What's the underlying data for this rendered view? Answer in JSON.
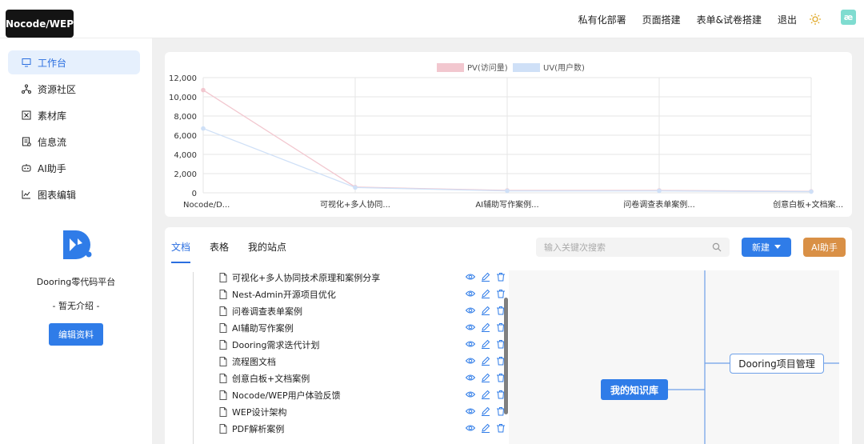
{
  "app": {
    "logo": "Nocode/WEP"
  },
  "topnav": [
    "私有化部署",
    "页面搭建",
    "表单&试卷搭建",
    "退出"
  ],
  "user_avatar": "æ",
  "sidebar": {
    "items": [
      {
        "label": "工作台",
        "icon": "monitor-icon",
        "active": true
      },
      {
        "label": "资源社区",
        "icon": "share-icon",
        "active": false
      },
      {
        "label": "素材库",
        "icon": "library-icon",
        "active": false
      },
      {
        "label": "信息流",
        "icon": "feed-icon",
        "active": false
      },
      {
        "label": "AI助手",
        "icon": "robot-icon",
        "active": false
      },
      {
        "label": "图表编辑",
        "icon": "chart-icon",
        "active": false
      }
    ]
  },
  "profile": {
    "name": "Dooring零代码平台",
    "desc": "- 暂无介绍 -",
    "edit_label": "编辑资料"
  },
  "chart_data": {
    "type": "line",
    "categories": [
      "Nocode/D...",
      "可视化+多人协同...",
      "AI辅助写作案例...",
      "问卷调查表单案例...",
      "创意白板+文档案..."
    ],
    "series": [
      {
        "name": "PV(访问量)",
        "values": [
          10700,
          600,
          250,
          250,
          150
        ],
        "color": "#f2c7cf"
      },
      {
        "name": "UV(用户数)",
        "values": [
          6700,
          550,
          200,
          200,
          120
        ],
        "color": "#cfe0f7"
      }
    ],
    "yticks": [
      "0",
      "2,000",
      "4,000",
      "6,000",
      "8,000",
      "10,000",
      "12,000"
    ],
    "ylim": [
      0,
      12000
    ],
    "legend": "top-center",
    "grid": true
  },
  "tabs": [
    {
      "label": "文档",
      "active": true
    },
    {
      "label": "表格",
      "active": false
    },
    {
      "label": "我的站点",
      "active": false
    }
  ],
  "search": {
    "placeholder": "输入关键次搜索"
  },
  "buttons": {
    "new": "新建",
    "ai": "AI助手"
  },
  "files": [
    "可视化+多人协同技术原理和案例分享",
    "Nest-Admin开源项目优化",
    "问卷调查表单案例",
    "AI辅助写作案例",
    "Dooring需求迭代计划",
    "流程图文档",
    "创意白板+文档案例",
    "Nocode/WEP用户体验反馈",
    "WEP设计架构",
    "PDF解析案例"
  ],
  "mindmap": {
    "root": "我的知识库",
    "child": "Dooring项目管理"
  }
}
